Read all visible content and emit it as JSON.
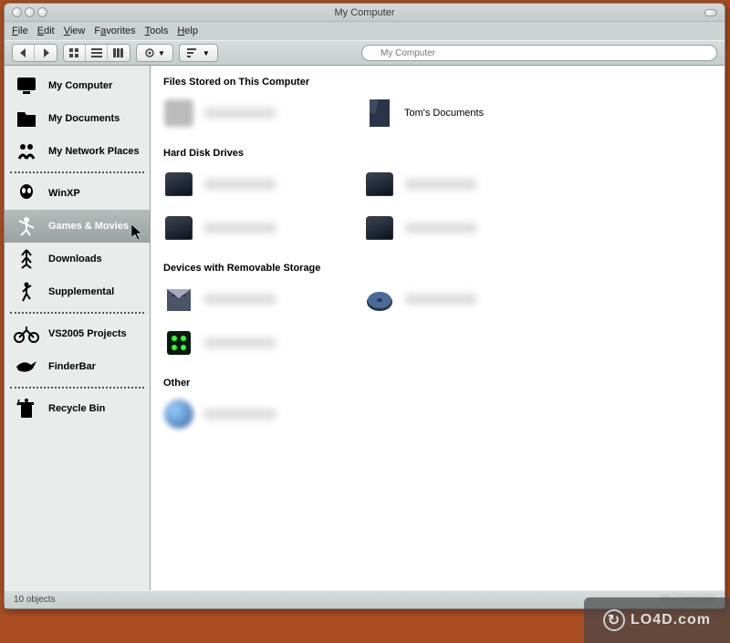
{
  "window": {
    "title": "My Computer"
  },
  "menu": {
    "file": "File",
    "edit": "Edit",
    "view": "View",
    "favorites": "Favorites",
    "tools": "Tools",
    "help": "Help"
  },
  "search": {
    "placeholder": "My Computer"
  },
  "sidebar": {
    "items": [
      {
        "label": "My Computer",
        "icon": "monitor"
      },
      {
        "label": "My Documents",
        "icon": "folder"
      },
      {
        "label": "My Network Places",
        "icon": "people"
      },
      {
        "sep": true
      },
      {
        "label": "WinXP",
        "icon": "alien"
      },
      {
        "label": "Games & Movies",
        "icon": "dancer",
        "selected": true
      },
      {
        "label": "Downloads",
        "icon": "down"
      },
      {
        "label": "Supplemental",
        "icon": "runner"
      },
      {
        "sep": true
      },
      {
        "label": "VS2005 Projects",
        "icon": "bike"
      },
      {
        "label": "FinderBar",
        "icon": "bird"
      },
      {
        "sep": true
      },
      {
        "label": "Recycle Bin",
        "icon": "trash"
      }
    ]
  },
  "sections": [
    {
      "title": "Files Stored on This Computer",
      "items": [
        {
          "label": "",
          "blurred": true,
          "icon": "folder-blur"
        },
        {
          "label": "Tom's Documents",
          "icon": "folder-dark"
        }
      ]
    },
    {
      "title": "Hard Disk Drives",
      "items": [
        {
          "label": "",
          "blurred": true,
          "icon": "drive"
        },
        {
          "label": "",
          "blurred": true,
          "icon": "drive"
        },
        {
          "label": "",
          "blurred": true,
          "icon": "drive"
        },
        {
          "label": "",
          "blurred": true,
          "icon": "drive"
        }
      ]
    },
    {
      "title": "Devices with Removable Storage",
      "items": [
        {
          "label": "",
          "blurred": true,
          "icon": "floppy"
        },
        {
          "label": "",
          "blurred": true,
          "icon": "optical"
        },
        {
          "label": "",
          "blurred": true,
          "icon": "device"
        }
      ]
    },
    {
      "title": "Other",
      "items": [
        {
          "label": "",
          "blurred": true,
          "icon": "globe"
        }
      ]
    }
  ],
  "statusbar": {
    "count": "10 objects",
    "right": "My Computer"
  },
  "watermark": "LO4D.com"
}
